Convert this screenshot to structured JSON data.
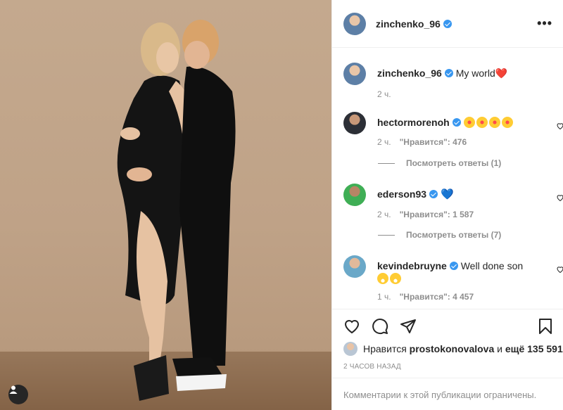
{
  "post": {
    "username": "zinchenko_96",
    "more_icon": "ellipsis-icon"
  },
  "caption": {
    "username": "zinchenko_96",
    "text": "My world",
    "emoji": "❤️",
    "time": "2 ч."
  },
  "comments": [
    {
      "username": "hectormorenoh",
      "text": "",
      "emoji": [
        "🤩",
        "🤩",
        "🤩",
        "🤩"
      ],
      "time": "2 ч.",
      "likes": "\"Нравится\": 476",
      "replies": "Посмотреть ответы (1)"
    },
    {
      "username": "ederson93",
      "text": "",
      "emoji": [
        "💙"
      ],
      "time": "2 ч.",
      "likes": "\"Нравится\": 1 587",
      "replies": "Посмотреть ответы (7)"
    },
    {
      "username": "kevindebruyne",
      "text": "Well done son",
      "emoji": [
        "😂",
        "😂"
      ],
      "time": "1 ч.",
      "likes": "\"Нравится\": 4 457",
      "replies": ""
    }
  ],
  "likes_summary": {
    "prefix": "Нравится",
    "user": "prostokonovalova",
    "conj": "и",
    "others": "ещё 135 591"
  },
  "posted_time": "2 ЧАСОВ НАЗАД",
  "comments_closed": "Комментарии к этой публикации ограничены.",
  "colors": {
    "verified": "#3897f0",
    "secondary_text": "#8e8e8e",
    "border": "#efefef",
    "background_photo": "#c4a98e"
  }
}
